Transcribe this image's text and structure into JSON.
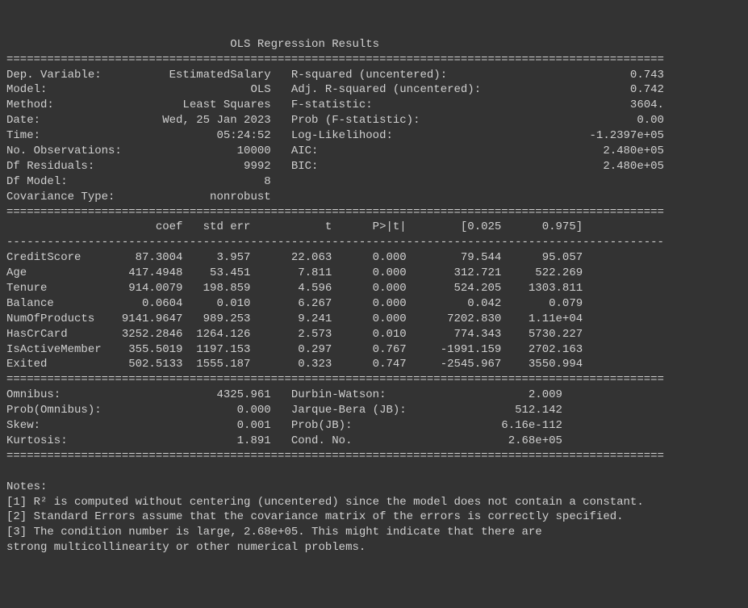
{
  "title": "OLS Regression Results",
  "header_left": [
    {
      "label": "Dep. Variable:",
      "value": "EstimatedSalary"
    },
    {
      "label": "Model:",
      "value": "OLS"
    },
    {
      "label": "Method:",
      "value": "Least Squares"
    },
    {
      "label": "Date:",
      "value": "Wed, 25 Jan 2023"
    },
    {
      "label": "Time:",
      "value": "05:24:52"
    },
    {
      "label": "No. Observations:",
      "value": "10000"
    },
    {
      "label": "Df Residuals:",
      "value": "9992"
    },
    {
      "label": "Df Model:",
      "value": "8"
    },
    {
      "label": "Covariance Type:",
      "value": "nonrobust"
    }
  ],
  "header_right": [
    {
      "label": "R-squared (uncentered):",
      "value": "0.743"
    },
    {
      "label": "Adj. R-squared (uncentered):",
      "value": "0.742"
    },
    {
      "label": "F-statistic:",
      "value": "3604."
    },
    {
      "label": "Prob (F-statistic):",
      "value": "0.00"
    },
    {
      "label": "Log-Likelihood:",
      "value": "-1.2397e+05"
    },
    {
      "label": "AIC:",
      "value": "2.480e+05"
    },
    {
      "label": "BIC:",
      "value": "2.480e+05"
    }
  ],
  "coef_headers": [
    "",
    "coef",
    "std err",
    "t",
    "P>|t|",
    "[0.025",
    "0.975]"
  ],
  "coef_rows": [
    {
      "name": "CreditScore",
      "coef": "87.3004",
      "stderr": "3.957",
      "t": "22.063",
      "p": "0.000",
      "lo": "79.544",
      "hi": "95.057"
    },
    {
      "name": "Age",
      "coef": "417.4948",
      "stderr": "53.451",
      "t": "7.811",
      "p": "0.000",
      "lo": "312.721",
      "hi": "522.269"
    },
    {
      "name": "Tenure",
      "coef": "914.0079",
      "stderr": "198.859",
      "t": "4.596",
      "p": "0.000",
      "lo": "524.205",
      "hi": "1303.811"
    },
    {
      "name": "Balance",
      "coef": "0.0604",
      "stderr": "0.010",
      "t": "6.267",
      "p": "0.000",
      "lo": "0.042",
      "hi": "0.079"
    },
    {
      "name": "NumOfProducts",
      "coef": "9141.9647",
      "stderr": "989.253",
      "t": "9.241",
      "p": "0.000",
      "lo": "7202.830",
      "hi": "1.11e+04"
    },
    {
      "name": "HasCrCard",
      "coef": "3252.2846",
      "stderr": "1264.126",
      "t": "2.573",
      "p": "0.010",
      "lo": "774.343",
      "hi": "5730.227"
    },
    {
      "name": "IsActiveMember",
      "coef": "355.5019",
      "stderr": "1197.153",
      "t": "0.297",
      "p": "0.767",
      "lo": "-1991.159",
      "hi": "2702.163"
    },
    {
      "name": "Exited",
      "coef": "502.5133",
      "stderr": "1555.187",
      "t": "0.323",
      "p": "0.747",
      "lo": "-2545.967",
      "hi": "3550.994"
    }
  ],
  "footer_left": [
    {
      "label": "Omnibus:",
      "value": "4325.961"
    },
    {
      "label": "Prob(Omnibus):",
      "value": "0.000"
    },
    {
      "label": "Skew:",
      "value": "0.001"
    },
    {
      "label": "Kurtosis:",
      "value": "1.891"
    }
  ],
  "footer_right": [
    {
      "label": "Durbin-Watson:",
      "value": "2.009"
    },
    {
      "label": "Jarque-Bera (JB):",
      "value": "512.142"
    },
    {
      "label": "Prob(JB):",
      "value": "6.16e-112"
    },
    {
      "label": "Cond. No.",
      "value": "2.68e+05"
    }
  ],
  "notes_header": "Notes:",
  "notes": [
    "[1] R² is computed without centering (uncentered) since the model does not contain a constant.",
    "[2] Standard Errors assume that the covariance matrix of the errors is correctly specified.",
    "[3] The condition number is large, 2.68e+05. This might indicate that there are",
    "strong multicollinearity or other numerical problems."
  ],
  "chart_data": {
    "type": "table",
    "title": "OLS Regression Results",
    "dep_variable": "EstimatedSalary",
    "coefficients": {
      "CreditScore": 87.3004,
      "Age": 417.4948,
      "Tenure": 914.0079,
      "Balance": 0.0604,
      "NumOfProducts": 9141.9647,
      "HasCrCard": 3252.2846,
      "IsActiveMember": 355.5019,
      "Exited": 502.5133
    },
    "r_squared": 0.743,
    "adj_r_squared": 0.742,
    "f_statistic": 3604,
    "n_obs": 10000
  }
}
